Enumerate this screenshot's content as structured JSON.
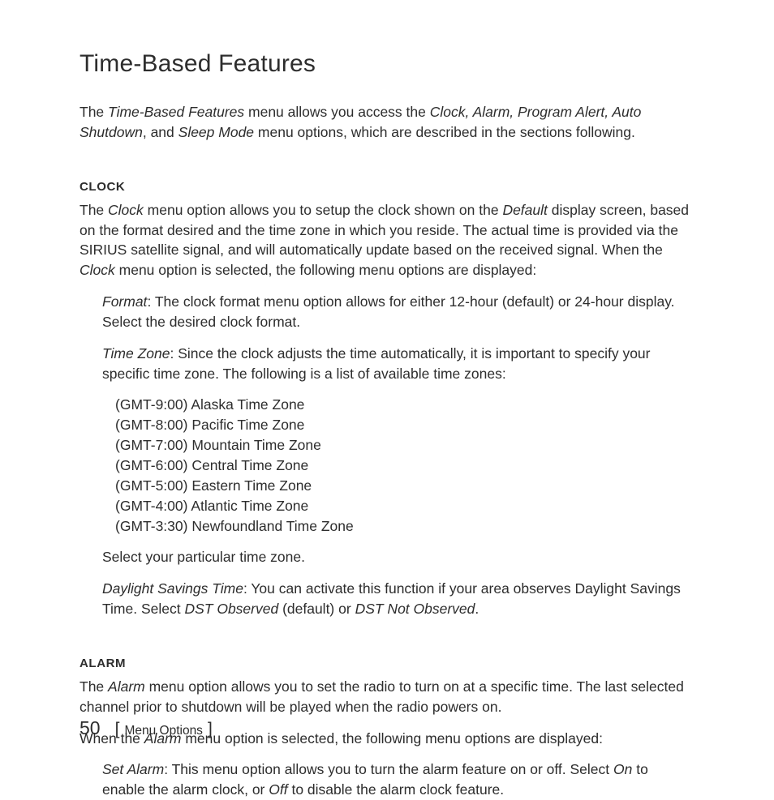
{
  "title": "Time-Based Features",
  "intro_parts": {
    "p1": "The ",
    "i1": "Time-Based Features",
    "p2": " menu allows you access the ",
    "i2": "Clock, Alarm, Program Alert, Auto Shutdown",
    "p3": ", and ",
    "i3": "Sleep Mode",
    "p4": " menu options, which are described in the sections following."
  },
  "clock": {
    "heading": "CLOCK",
    "p1": {
      "a": "The ",
      "i1": "Clock",
      "b": " menu option allows you to setup the clock shown on the ",
      "i2": "Default",
      "c": " display screen, based on the format desired and the time zone in which you reside. The actual time is provided via the SIRIUS satellite signal, and will automatically update based on the received signal. When the ",
      "i3": "Clock",
      "d": " menu option is selected, the following menu options are displayed:"
    },
    "format": {
      "i": "Format",
      "t": ": The clock format menu option allows for either 12-hour (default) or 24-hour display. Select the desired clock format."
    },
    "tz_intro": {
      "i": "Time Zone",
      "t": ": Since the clock adjusts the time automatically, it is important to specify your specific time zone. The following is a list of available time zones:"
    },
    "timezones": [
      "(GMT-9:00) Alaska Time Zone",
      "(GMT-8:00) Pacific Time Zone",
      "(GMT-7:00) Mountain Time Zone",
      "(GMT-6:00) Central Time Zone",
      "(GMT-5:00) Eastern Time Zone",
      "(GMT-4:00) Atlantic Time Zone",
      "(GMT-3:30) Newfoundland Time Zone"
    ],
    "select_tz": "Select your particular time zone.",
    "dst": {
      "i1": "Daylight Savings Time",
      "t1": ": You can activate this function if your area observes Daylight Savings Time. Select ",
      "i2": "DST Observed",
      "t2": " (default) or ",
      "i3": "DST Not Observed",
      "t3": "."
    }
  },
  "alarm": {
    "heading": "ALARM",
    "p1": {
      "a": "The ",
      "i1": "Alarm",
      "b": " menu option allows you to set the radio to turn on at a specific time. The last selected channel prior to shutdown will be played when the radio powers on."
    },
    "p2": {
      "a": "When the ",
      "i1": "Alarm",
      "b": " menu option is selected, the following menu options are displayed:"
    },
    "set_alarm": {
      "i1": "Set Alarm",
      "t1": ": This menu option allows you to turn the alarm feature on or off. Select ",
      "i2": "On",
      "t2": " to enable the alarm clock, or ",
      "i3": "Off",
      "t3": " to disable the alarm clock feature."
    }
  },
  "footer": {
    "page_num": "50",
    "label": "Menu Options"
  }
}
